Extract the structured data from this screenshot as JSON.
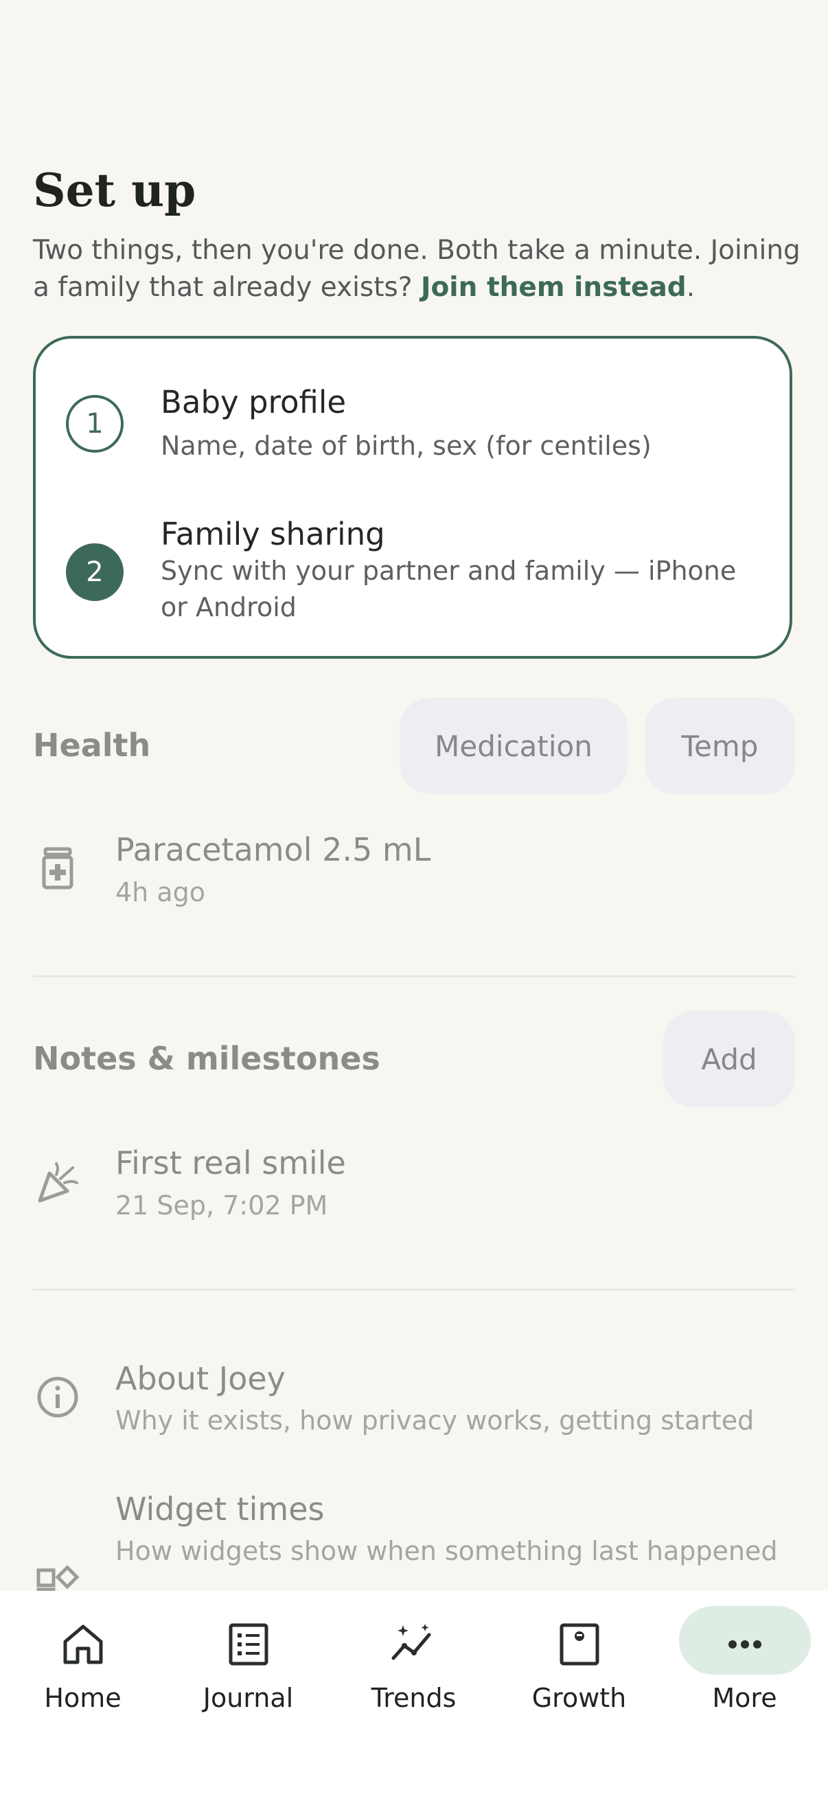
{
  "setup": {
    "title": "Set up",
    "subtitle_text": "Two things, then you're done. Both take a minute. Joining a family that already exists? ",
    "subtitle_link": "Join them instead",
    "subtitle_end": ".",
    "steps": [
      {
        "number": "1",
        "title": "Baby profile",
        "desc": "Name, date of birth, sex (for centiles)",
        "state": "outline"
      },
      {
        "number": "2",
        "title": "Family sharing",
        "desc": "Sync with your partner and family — iPhone or Android",
        "state": "filled"
      }
    ]
  },
  "health": {
    "title": "Health",
    "buttons": [
      "Medication",
      "Temp"
    ],
    "entry": {
      "title": "Paracetamol 2.5 mL",
      "time": "4h ago",
      "icon": "medicine-bottle-icon"
    }
  },
  "notes": {
    "title": "Notes & milestones",
    "add_label": "Add",
    "entry": {
      "title": "First real smile",
      "time": "21 Sep, 7:02 PM",
      "icon": "party-popper-icon"
    }
  },
  "links": [
    {
      "title": "About Joey",
      "desc": "Why it exists, how privacy works, getting started",
      "icon": "info-icon"
    },
    {
      "title": "Widget times",
      "desc": "How widgets show when something last happened",
      "icon": "widgets-icon"
    }
  ],
  "tabs": [
    {
      "label": "Home",
      "icon": "home-icon"
    },
    {
      "label": "Journal",
      "icon": "journal-icon"
    },
    {
      "label": "Trends",
      "icon": "trends-icon"
    },
    {
      "label": "Growth",
      "icon": "growth-icon"
    },
    {
      "label": "More",
      "icon": "more-icon",
      "active": true
    }
  ],
  "colors": {
    "accent": "#3d6a58",
    "background": "#f8f6f1",
    "pill": "#efedf1",
    "active_tab": "#dfece3"
  }
}
